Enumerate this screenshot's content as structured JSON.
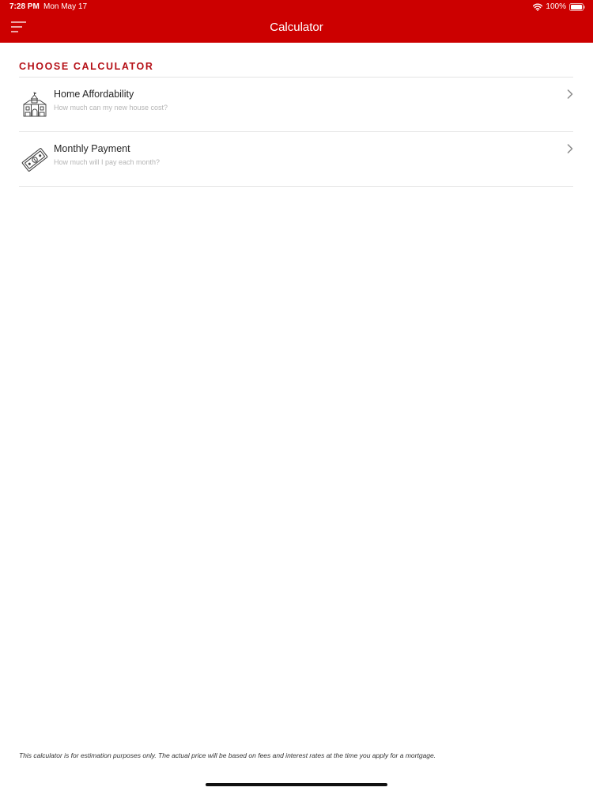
{
  "status_bar": {
    "time": "7:28 PM",
    "date": "Mon May 17",
    "battery_percent": "100%",
    "icons": [
      "wifi-icon",
      "battery-icon"
    ]
  },
  "nav": {
    "title": "Calculator",
    "menu_icon": "hamburger-menu-icon"
  },
  "section": {
    "title": "CHOOSE CALCULATOR"
  },
  "calculators": [
    {
      "title": "Home Affordability",
      "subtitle": "How much can my new house cost?",
      "icon": "house-icon"
    },
    {
      "title": "Monthly Payment",
      "subtitle": "How much will I pay each month?",
      "icon": "money-bill-icon"
    }
  ],
  "footer": {
    "disclaimer": "This calculator is for estimation purposes only. The actual price will be based on fees and interest rates at the time you apply for a mortgage."
  },
  "colors": {
    "brand_red": "#cc0000",
    "section_title_red": "#b50f16",
    "divider": "#e4e4e4",
    "subtitle_gray": "#b5b5b5"
  }
}
